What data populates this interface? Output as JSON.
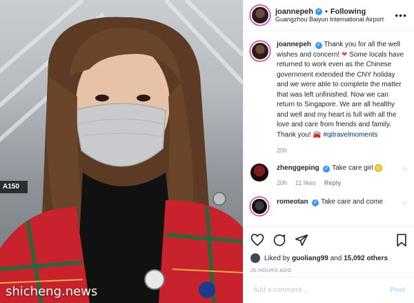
{
  "header": {
    "username": "joannepeh",
    "separator": "•",
    "follow_label": "Following",
    "location": "Guangzhou Baiyun International Airport",
    "more_icon": "more-options-icon"
  },
  "photo": {
    "sign_text": "A150",
    "watermark": "shicheng.news"
  },
  "caption": {
    "username": "joannepeh",
    "text": "Thank you for all the well wishes and concern!",
    "emoji": "❤",
    "text2": "Some locals have returned to work even as the Chinese government extended the CNY holiday and we were able to complete the matter that was left unfinished. Now we can return to Singapore. We are all healthy and well and my heart is full with all the love and care from friends and family. Thank you!",
    "hashtag": "#qitravelmoments",
    "time": "20h"
  },
  "comments": [
    {
      "username": "zhenggeping",
      "text": "Take care girl",
      "time": "20h",
      "likes": "11 likes",
      "reply_label": "Reply"
    },
    {
      "username": "romeotan",
      "text": "Take care and come"
    }
  ],
  "actions": {
    "liked_by_prefix": "Liked by",
    "liked_by_user": "guoliang99",
    "liked_by_and": "and",
    "liked_by_count": "15,092 others",
    "timestamp": "20 HOURS AGO"
  },
  "add_comment": {
    "placeholder": "Add a comment...",
    "post_label": "Post"
  },
  "colors": {
    "verified": "#3897f0",
    "link": "#00376b",
    "post_disabled": "#b2dffc",
    "heart": "#ed4956"
  }
}
